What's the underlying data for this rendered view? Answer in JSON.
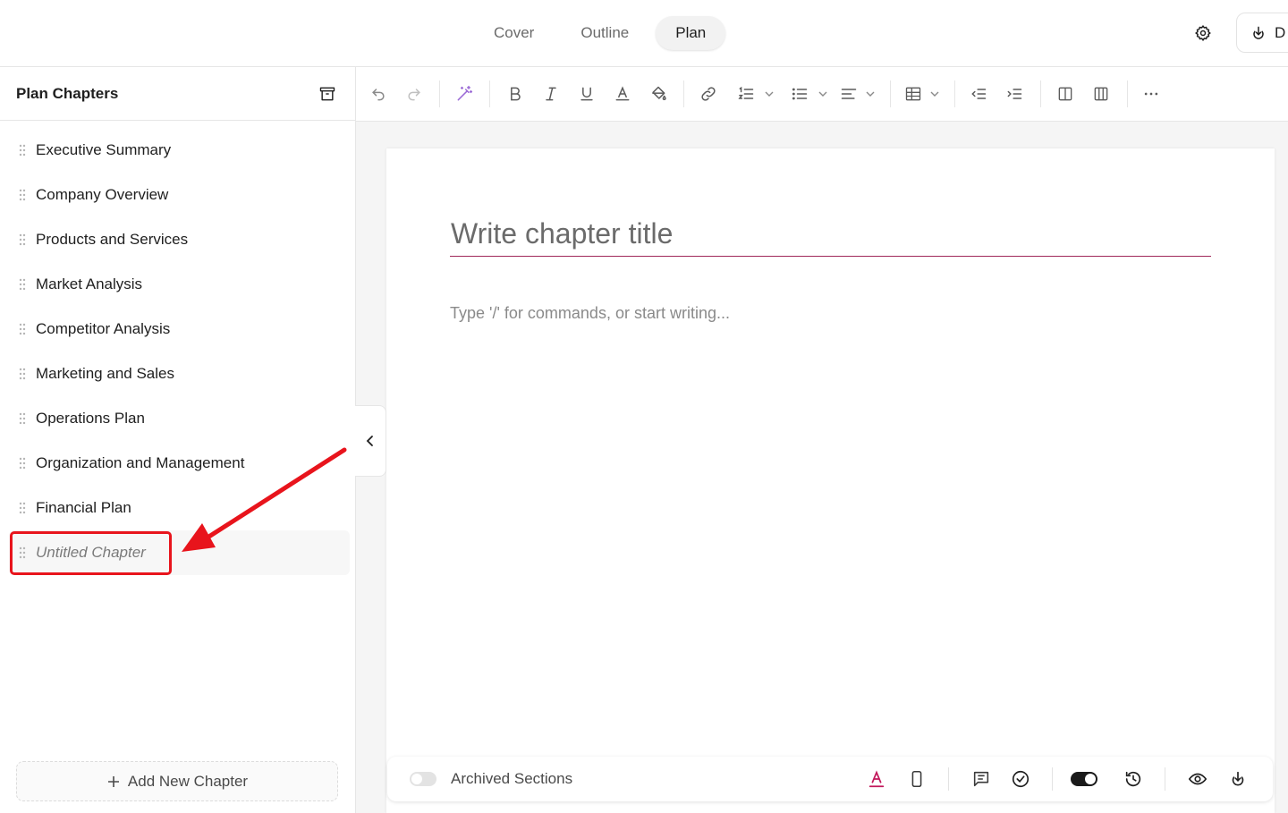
{
  "top_tabs": [
    {
      "label": "Cover",
      "active": false
    },
    {
      "label": "Outline",
      "active": false
    },
    {
      "label": "Plan",
      "active": true
    }
  ],
  "top_download_label": "D",
  "sidebar": {
    "title": "Plan Chapters",
    "chapters": [
      {
        "label": "Executive Summary"
      },
      {
        "label": "Company Overview"
      },
      {
        "label": "Products and Services"
      },
      {
        "label": "Market Analysis"
      },
      {
        "label": "Competitor Analysis"
      },
      {
        "label": "Marketing and Sales"
      },
      {
        "label": "Operations Plan"
      },
      {
        "label": "Organization and Management"
      },
      {
        "label": "Financial Plan"
      },
      {
        "label": "Untitled Chapter",
        "selected": true
      }
    ],
    "add_button_label": "Add New Chapter"
  },
  "toolbar": {
    "icons": [
      "undo-icon",
      "redo-icon",
      "ai-magic-wand-icon",
      "bold-icon",
      "italic-icon",
      "underline-icon",
      "text-color-icon",
      "fill-color-icon",
      "link-icon",
      "numbered-list-icon",
      "bullet-list-icon",
      "align-icon",
      "table-icon",
      "outdent-icon",
      "indent-icon",
      "column-single-icon",
      "column-double-icon",
      "more-icon"
    ]
  },
  "editor": {
    "title_placeholder": "Write chapter title",
    "body_placeholder": "Type '/' for commands, or start writing..."
  },
  "bottom_bar": {
    "archived_label": "Archived Sections",
    "archived_toggle_on": false,
    "dark_toggle_on": true
  },
  "colors": {
    "accent": "#c2185b",
    "highlight": "#e8141c",
    "title_underline": "#a0285a"
  }
}
